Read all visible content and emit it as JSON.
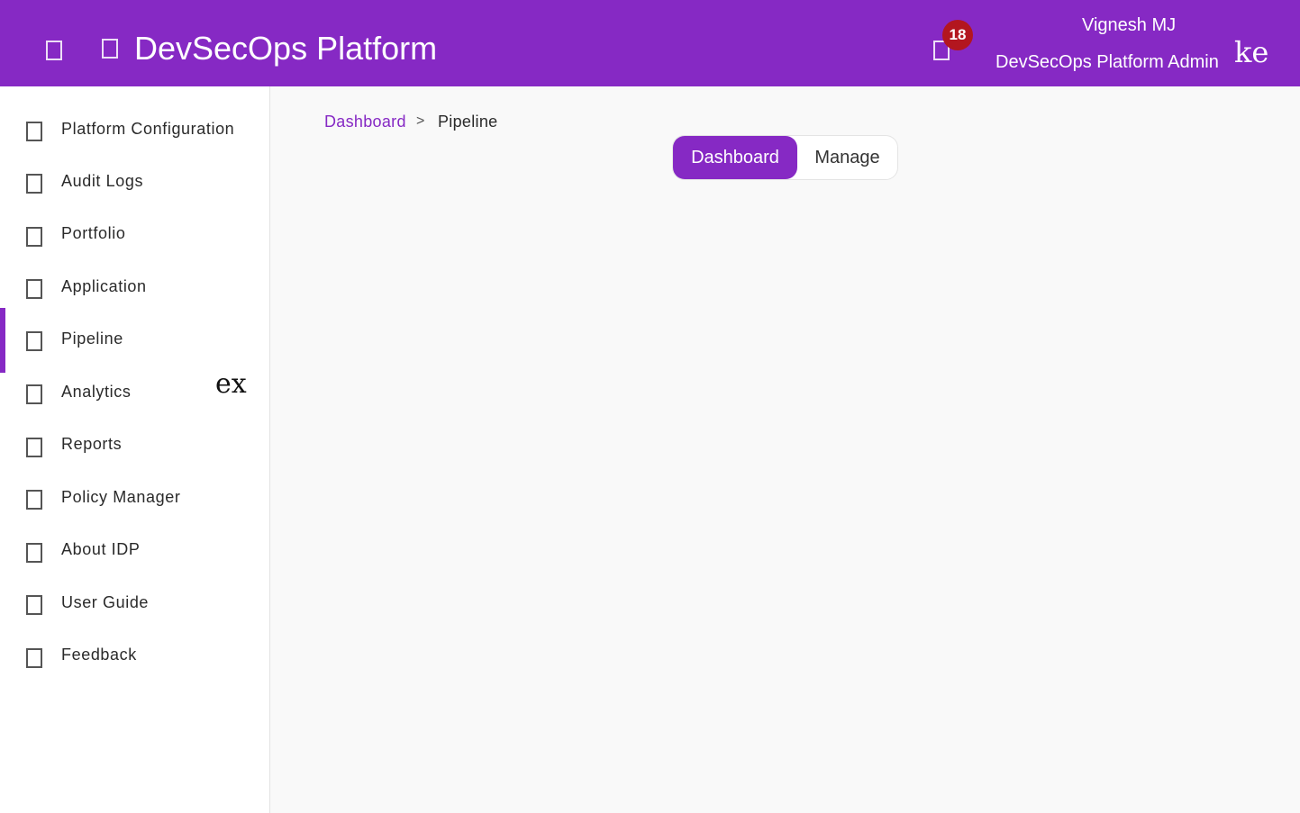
{
  "header": {
    "title": "DevSecOps Platform",
    "notification_count": "18",
    "user_name": "Vignesh MJ",
    "user_role": "DevSecOps Platform Admin",
    "user_glyph": "ke",
    "icons": [
      "menu-icon",
      "app-icon",
      "bell-icon"
    ]
  },
  "sidebar": {
    "items": [
      {
        "label": "Platform Configuration",
        "icon": "settings-icon"
      },
      {
        "label": "Audit Logs",
        "icon": "audit-icon"
      },
      {
        "label": "Portfolio",
        "icon": "portfolio-icon"
      },
      {
        "label": "Application",
        "icon": "application-icon"
      },
      {
        "label": "Pipeline",
        "icon": "pipeline-icon",
        "active": true
      },
      {
        "label": "Analytics",
        "icon": "analytics-icon"
      },
      {
        "label": "Reports",
        "icon": "reports-icon"
      },
      {
        "label": "Policy Manager",
        "icon": "policy-icon"
      },
      {
        "label": "About IDP",
        "icon": "info-icon"
      },
      {
        "label": "User Guide",
        "icon": "guide-icon"
      },
      {
        "label": "Feedback",
        "icon": "feedback-icon"
      }
    ],
    "stray_glyph": "ex"
  },
  "breadcrumb": {
    "home": "Dashboard",
    "separator": ">",
    "current": "Pipeline"
  },
  "toggle": {
    "options": [
      "Dashboard",
      "Manage"
    ],
    "selected": "Dashboard"
  },
  "colors": {
    "brand": "#8629c4",
    "badge": "#b3161f"
  }
}
